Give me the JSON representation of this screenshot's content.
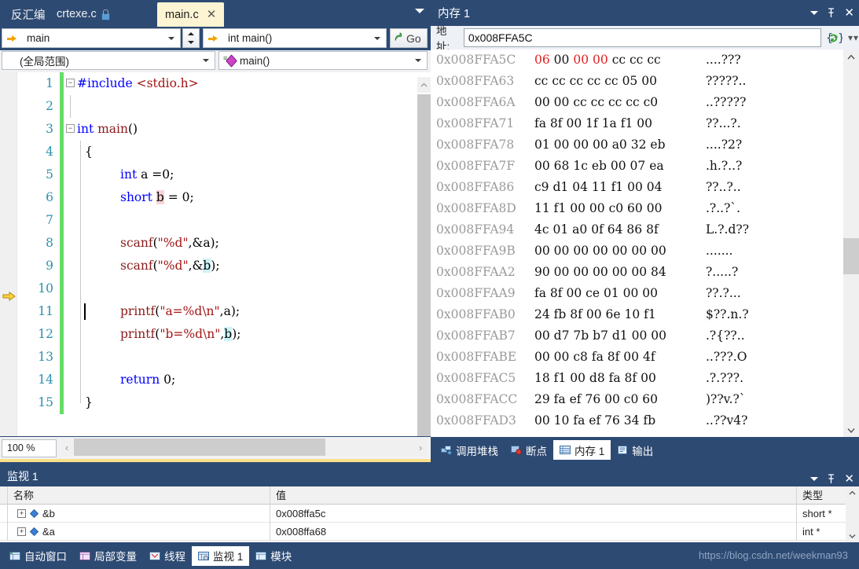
{
  "editor": {
    "tabs": [
      {
        "label": "反汇编",
        "active": false,
        "has_lock": false,
        "closable": false
      },
      {
        "label": "crtexe.c",
        "active": false,
        "has_lock": true,
        "closable": false
      },
      {
        "label": "main.c",
        "active": true,
        "has_lock": false,
        "closable": true,
        "close_label": "✕"
      }
    ],
    "nav": {
      "project_value": "main",
      "function_value": "int main()",
      "go_label": "Go",
      "scope_value": "(全局范围)",
      "member_value": "main()"
    },
    "zoom_level": "100 %",
    "lines": [
      {
        "n": "1",
        "fold": "−",
        "text": "#include <stdio.h>"
      },
      {
        "n": "2",
        "fold": "",
        "text": ""
      },
      {
        "n": "3",
        "fold": "−",
        "text": "int main()"
      },
      {
        "n": "4",
        "fold": "",
        "text": "{"
      },
      {
        "n": "5",
        "fold": "",
        "text": "    int a =0;"
      },
      {
        "n": "6",
        "fold": "",
        "text": "    short b = 0;"
      },
      {
        "n": "7",
        "fold": "",
        "text": ""
      },
      {
        "n": "8",
        "fold": "",
        "text": "    scanf(\"%d\",&a);"
      },
      {
        "n": "9",
        "fold": "",
        "text": "    scanf(\"%d\",&b);"
      },
      {
        "n": "10",
        "fold": "",
        "text": ""
      },
      {
        "n": "11",
        "fold": "",
        "text": "    printf(\"a=%d\\n\",a);"
      },
      {
        "n": "12",
        "fold": "",
        "text": "    printf(\"b=%d\\n\",b);"
      },
      {
        "n": "13",
        "fold": "",
        "text": ""
      },
      {
        "n": "14",
        "fold": "",
        "text": "    return 0;"
      },
      {
        "n": "15",
        "fold": "",
        "text": "}"
      }
    ],
    "execution_line": "11"
  },
  "memory": {
    "title": "内存 1",
    "address_label": "地址:",
    "address_value": "0x008FFA5C",
    "rows": [
      {
        "addr": "0x008FFA5C",
        "bytes": [
          "06",
          "00",
          "00",
          "00",
          "cc",
          "cc",
          "cc"
        ],
        "changed": [
          true,
          false,
          true,
          true,
          false,
          false,
          false
        ],
        "ascii": "....???"
      },
      {
        "addr": "0x008FFA63",
        "bytes": [
          "cc",
          "cc",
          "cc",
          "cc",
          "cc",
          "05",
          "00"
        ],
        "changed": [
          false,
          false,
          false,
          false,
          false,
          false,
          false
        ],
        "ascii": "?????.."
      },
      {
        "addr": "0x008FFA6A",
        "bytes": [
          "00",
          "00",
          "cc",
          "cc",
          "cc",
          "cc",
          "c0"
        ],
        "changed": [
          false,
          false,
          false,
          false,
          false,
          false,
          false
        ],
        "ascii": "..?????"
      },
      {
        "addr": "0x008FFA71",
        "bytes": [
          "fa",
          "8f",
          "00",
          "1f",
          "1a",
          "f1",
          "00"
        ],
        "changed": [
          false,
          false,
          false,
          false,
          false,
          false,
          false
        ],
        "ascii": "??...?."
      },
      {
        "addr": "0x008FFA78",
        "bytes": [
          "01",
          "00",
          "00",
          "00",
          "a0",
          "32",
          "eb"
        ],
        "changed": [
          false,
          false,
          false,
          false,
          false,
          false,
          false
        ],
        "ascii": "....?2?"
      },
      {
        "addr": "0x008FFA7F",
        "bytes": [
          "00",
          "68",
          "1c",
          "eb",
          "00",
          "07",
          "ea"
        ],
        "changed": [
          false,
          false,
          false,
          false,
          false,
          false,
          false
        ],
        "ascii": ".h.?..?"
      },
      {
        "addr": "0x008FFA86",
        "bytes": [
          "c9",
          "d1",
          "04",
          "11",
          "f1",
          "00",
          "04"
        ],
        "changed": [
          false,
          false,
          false,
          false,
          false,
          false,
          false
        ],
        "ascii": "??..?.."
      },
      {
        "addr": "0x008FFA8D",
        "bytes": [
          "11",
          "f1",
          "00",
          "00",
          "c0",
          "60",
          "00"
        ],
        "changed": [
          false,
          false,
          false,
          false,
          false,
          false,
          false
        ],
        "ascii": ".?..?`."
      },
      {
        "addr": "0x008FFA94",
        "bytes": [
          "4c",
          "01",
          "a0",
          "0f",
          "64",
          "86",
          "8f"
        ],
        "changed": [
          false,
          false,
          false,
          false,
          false,
          false,
          false
        ],
        "ascii": "L.?.d??"
      },
      {
        "addr": "0x008FFA9B",
        "bytes": [
          "00",
          "00",
          "00",
          "00",
          "00",
          "00",
          "00"
        ],
        "changed": [
          false,
          false,
          false,
          false,
          false,
          false,
          false
        ],
        "ascii": "......."
      },
      {
        "addr": "0x008FFAA2",
        "bytes": [
          "90",
          "00",
          "00",
          "00",
          "00",
          "00",
          "84"
        ],
        "changed": [
          false,
          false,
          false,
          false,
          false,
          false,
          false
        ],
        "ascii": "?.....?"
      },
      {
        "addr": "0x008FFAA9",
        "bytes": [
          "fa",
          "8f",
          "00",
          "ce",
          "01",
          "00",
          "00"
        ],
        "changed": [
          false,
          false,
          false,
          false,
          false,
          false,
          false
        ],
        "ascii": "??.?..."
      },
      {
        "addr": "0x008FFAB0",
        "bytes": [
          "24",
          "fb",
          "8f",
          "00",
          "6e",
          "10",
          "f1"
        ],
        "changed": [
          false,
          false,
          false,
          false,
          false,
          false,
          false
        ],
        "ascii": "$??.n.?"
      },
      {
        "addr": "0x008FFAB7",
        "bytes": [
          "00",
          "d7",
          "7b",
          "b7",
          "d1",
          "00",
          "00"
        ],
        "changed": [
          false,
          false,
          false,
          false,
          false,
          false,
          false
        ],
        "ascii": ".?{??.."
      },
      {
        "addr": "0x008FFABE",
        "bytes": [
          "00",
          "00",
          "c8",
          "fa",
          "8f",
          "00",
          "4f"
        ],
        "changed": [
          false,
          false,
          false,
          false,
          false,
          false,
          false
        ],
        "ascii": "..???.O"
      },
      {
        "addr": "0x008FFAC5",
        "bytes": [
          "18",
          "f1",
          "00",
          "d8",
          "fa",
          "8f",
          "00"
        ],
        "changed": [
          false,
          false,
          false,
          false,
          false,
          false,
          false
        ],
        "ascii": ".?.???."
      },
      {
        "addr": "0x008FFACC",
        "bytes": [
          "29",
          "fa",
          "ef",
          "76",
          "00",
          "c0",
          "60"
        ],
        "changed": [
          false,
          false,
          false,
          false,
          false,
          false,
          false
        ],
        "ascii": ")??v.?`"
      },
      {
        "addr": "0x008FFAD3",
        "bytes": [
          "00",
          "10",
          "fa",
          "ef",
          "76",
          "34",
          "fb"
        ],
        "changed": [
          false,
          false,
          false,
          false,
          false,
          false,
          false
        ],
        "ascii": "..??v4?"
      }
    ],
    "tabs": [
      {
        "label": "调用堆栈",
        "icon": "call-stack-icon",
        "active": false
      },
      {
        "label": "断点",
        "icon": "breakpoint-icon",
        "active": false
      },
      {
        "label": "内存 1",
        "icon": "memory-icon",
        "active": true
      },
      {
        "label": "输出",
        "icon": "output-icon",
        "active": false
      }
    ]
  },
  "watch": {
    "title": "监视 1",
    "columns": [
      "名称",
      "值",
      "类型"
    ],
    "rows": [
      {
        "name": "&b",
        "value": "0x008ffa5c",
        "type": "short *"
      },
      {
        "name": "&a",
        "value": "0x008ffa68",
        "type": "int *"
      }
    ]
  },
  "bottom_tabs": [
    {
      "label": "自动窗口",
      "active": false
    },
    {
      "label": "局部变量",
      "active": false
    },
    {
      "label": "线程",
      "active": false
    },
    {
      "label": "监视 1",
      "active": true
    },
    {
      "label": "模块",
      "active": false
    }
  ],
  "watermark": "https://blog.csdn.net/weekman93",
  "colors": {
    "chrome": "#2d4a73",
    "active_tab": "#fdf4d3",
    "changed_byte": "#e02020",
    "keyword": "#0000ff",
    "string": "#a31515",
    "line_number": "#2b91af",
    "change_bar": "#66dd66"
  }
}
